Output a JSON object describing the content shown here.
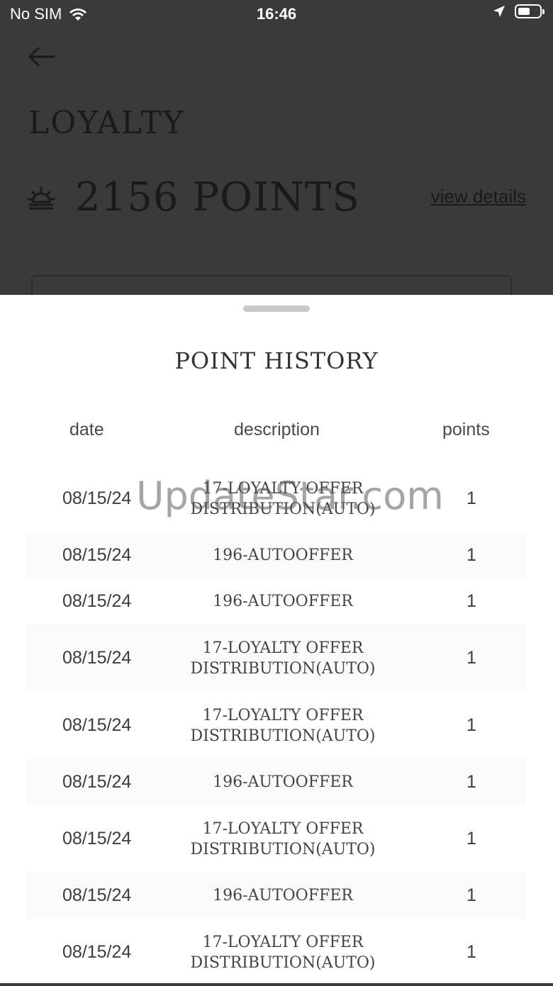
{
  "status_bar": {
    "carrier": "No SIM",
    "time": "16:46"
  },
  "header": {
    "title": "LOYALTY",
    "points": "2156 POINTS",
    "view_details": "view details"
  },
  "sheet": {
    "title": "POINT HISTORY",
    "columns": {
      "date": "date",
      "description": "description",
      "points": "points"
    },
    "rows": [
      {
        "date": "08/15/24",
        "desc1": "17-LOYALTY OFFER",
        "desc2": "DISTRIBUTION(AUTO)",
        "points": "1"
      },
      {
        "date": "08/15/24",
        "desc1": "196-AUTOOFFER",
        "desc2": "",
        "points": "1"
      },
      {
        "date": "08/15/24",
        "desc1": "196-AUTOOFFER",
        "desc2": "",
        "points": "1"
      },
      {
        "date": "08/15/24",
        "desc1": "17-LOYALTY OFFER",
        "desc2": "DISTRIBUTION(AUTO)",
        "points": "1"
      },
      {
        "date": "08/15/24",
        "desc1": "17-LOYALTY OFFER",
        "desc2": "DISTRIBUTION(AUTO)",
        "points": "1"
      },
      {
        "date": "08/15/24",
        "desc1": "196-AUTOOFFER",
        "desc2": "",
        "points": "1"
      },
      {
        "date": "08/15/24",
        "desc1": "17-LOYALTY OFFER",
        "desc2": "DISTRIBUTION(AUTO)",
        "points": "1"
      },
      {
        "date": "08/15/24",
        "desc1": "196-AUTOOFFER",
        "desc2": "",
        "points": "1"
      },
      {
        "date": "08/15/24",
        "desc1": "17-LOYALTY OFFER",
        "desc2": "DISTRIBUTION(AUTO)",
        "points": "1"
      }
    ]
  },
  "watermark": "UpdateStar.com"
}
